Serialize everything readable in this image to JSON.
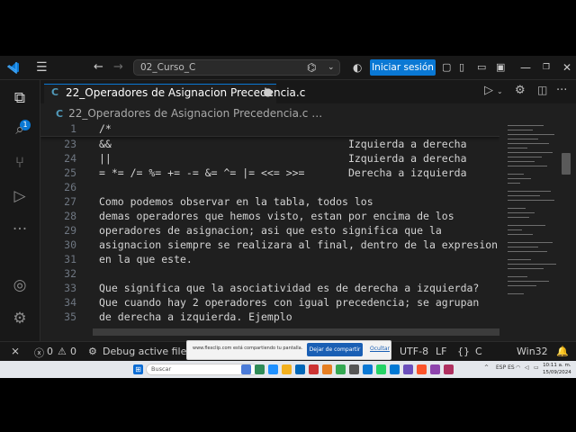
{
  "titlebar": {
    "command_center": "02_Curso_C",
    "signin": "Iniciar sesión"
  },
  "activity": {
    "badge": "1"
  },
  "tab": {
    "icon": "C",
    "name": "22_Operadores de Asignacion Precedencia.c",
    "close": "●"
  },
  "breadcrumb": {
    "icon": "C",
    "path": "22_Operadores de Asignacion Precedencia.c",
    "more": "…"
  },
  "editor": {
    "sticky": {
      "line": "1",
      "code": "/*"
    },
    "lines": [
      {
        "n": "23",
        "code": "&&                                      Izquierda a derecha"
      },
      {
        "n": "24",
        "code": "||                                      Izquierda a derecha"
      },
      {
        "n": "25",
        "code": "= *= /= %= += -= &= ^= |= <<= >>=       Derecha a izquierda"
      },
      {
        "n": "26",
        "code": ""
      },
      {
        "n": "27",
        "code": "Como podemos observar en la tabla, todos los"
      },
      {
        "n": "28",
        "code": "demas operadores que hemos visto, estan por encima de los"
      },
      {
        "n": "29",
        "code": "operadores de asignacion; asi que esto significa que la"
      },
      {
        "n": "30",
        "code": "asignacion siempre se realizara al final, dentro de la expresion"
      },
      {
        "n": "31",
        "code": "en la que este."
      },
      {
        "n": "32",
        "code": ""
      },
      {
        "n": "33",
        "code": "Que significa que la asociatividad es de derecha a izquierda?"
      },
      {
        "n": "34",
        "code": "Que cuando hay 2 operadores con igual precedencia; se agrupan"
      },
      {
        "n": "35",
        "code": "de derecha a izquierda. Ejemplo"
      }
    ]
  },
  "status": {
    "errors": "0",
    "warnings": "0",
    "debug": "Debug active file (M",
    "encoding": "UTF-8",
    "eol": "LF",
    "language": "C",
    "platform": "Win32"
  },
  "share": {
    "text": "www.flexclip.com está compartiendo tu pantalla.",
    "stop": "Dejar de compartir",
    "hide": "Ocultar"
  },
  "taskbar": {
    "search_placeholder": "Buscar",
    "lang": "ESP ES",
    "time": "10:11 a. m.",
    "date": "15/09/2024"
  }
}
